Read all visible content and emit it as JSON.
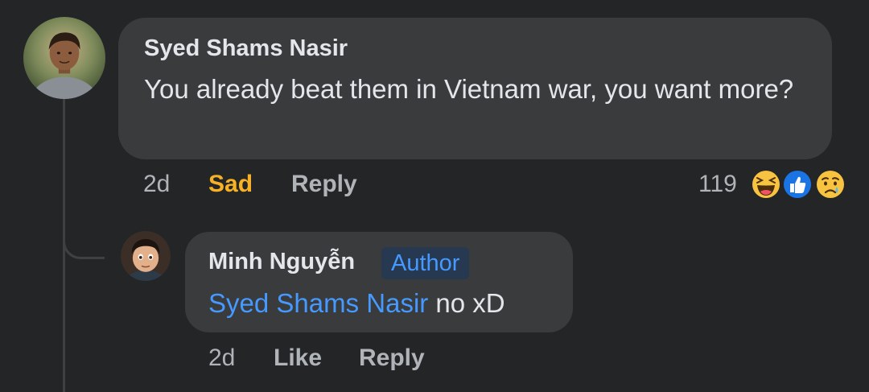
{
  "comment": {
    "author": "Syed Shams Nasir",
    "text": "You already beat them in Vietnam war, you want more?",
    "time": "2d",
    "reaction_label": "Sad",
    "reply_label": "Reply",
    "reaction_count": "119",
    "reaction_icons": [
      "haha-emoji-icon",
      "like-reaction-icon",
      "sad-emoji-icon"
    ],
    "reaction_color": "#f7b125"
  },
  "reply": {
    "author": "Minh Nguyễn",
    "badge": "Author",
    "mention": "Syed Shams Nasir",
    "text": " no xD",
    "time": "2d",
    "like_label": "Like",
    "reply_label": "Reply"
  },
  "colors": {
    "background": "#242526",
    "bubble": "#3a3b3c",
    "primary_text": "#e4e6eb",
    "secondary_text": "#b0b3b8",
    "link": "#4599ff",
    "badge_bg": "#263951"
  }
}
